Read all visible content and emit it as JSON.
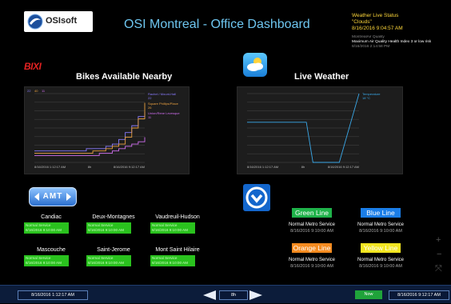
{
  "header": {
    "logo_text": "OSIsoft",
    "title": "OSI Montreal - Office Dashboard",
    "weather_status": {
      "label": "Weather Live Status",
      "condition": "\"Clouds\"",
      "timestamp": "8/16/2016 9:04:57 AM"
    },
    "air_quality": {
      "label": "MontrealAir Quality",
      "message": "Maximum Air Quality Health Index 3 or low risk",
      "timestamp": "8/16/2016 2:14:58 PM"
    }
  },
  "bikes": {
    "logo_text": "BIXI",
    "title": "Bikes Available Nearby",
    "legend_codes": [
      "22",
      "40",
      "11"
    ],
    "chart_data": {
      "type": "line",
      "title": "Bikes Available Nearby",
      "x_labels": [
        "8/16/2016 1:12:17 AM",
        "8h",
        "8/16/2016 9:12:17 AM"
      ],
      "series": [
        {
          "name": "Rachel / Mount-Hall",
          "value_text": "22",
          "color": "#8a7cff",
          "values": [
            5,
            5,
            5,
            5,
            5,
            5,
            5,
            5,
            6,
            6,
            6,
            7,
            8,
            10,
            13,
            16,
            20,
            22
          ]
        },
        {
          "name": "Square Phillips/Place",
          "value_text": "26",
          "color": "#e9a040",
          "values": [
            4,
            4,
            4,
            4,
            4,
            4,
            4,
            4,
            4,
            5,
            5,
            6,
            7,
            8,
            11,
            15,
            19,
            26
          ]
        },
        {
          "name": "Union/Rene Levesque",
          "value_text": "11",
          "color": "#d06ef0",
          "values": [
            3,
            3,
            3,
            3,
            3,
            3,
            3,
            3,
            3,
            3,
            4,
            4,
            5,
            6,
            7,
            8,
            9,
            11
          ]
        }
      ],
      "ylim": [
        0,
        30
      ],
      "grid": true
    }
  },
  "weather": {
    "icon": "cloud-sun-icon",
    "title": "Live Weather",
    "chart_data": {
      "type": "line",
      "title": "Live Weather",
      "x_labels": [
        "8/16/2016 1:12:17 AM",
        "8h",
        "8/16/2016 9:12:17 AM"
      ],
      "series": [
        {
          "name": "Temperature",
          "value_text": "18 °C",
          "color": "#3aa8e8",
          "values": [
            8,
            8,
            8,
            8,
            8,
            8,
            8,
            8,
            8,
            8,
            -6,
            -6,
            -6,
            -6,
            -6,
            2,
            10,
            18
          ]
        }
      ],
      "ylim": [
        -6,
        18
      ],
      "grid": true
    }
  },
  "amt": {
    "logo_text": "AMT",
    "stations": [
      {
        "name": "Candiac",
        "status": "Normal Service",
        "time": "8/16/2016 9:10:00 AM"
      },
      {
        "name": "Deux-Montagnes",
        "status": "Normal Service",
        "time": "8/16/2016 9:10:00 AM"
      },
      {
        "name": "Vaudreuil-Hudson",
        "status": "Normal Service",
        "time": "8/16/2016 9:10:00 AM"
      },
      {
        "name": "Mascouche",
        "status": "Normal Service",
        "time": "8/16/2016 9:10:00 AM"
      },
      {
        "name": "Saint-Jerome",
        "status": "Normal Service",
        "time": "8/16/2016 9:10:00 AM"
      },
      {
        "name": "Mont Saint Hilaire",
        "status": "Normal Service",
        "time": "8/16/2016 9:10:00 AM"
      }
    ]
  },
  "metro": {
    "icon": "metro-arrow-icon",
    "lines": [
      {
        "name": "Green Line",
        "bg": "#1fb34a",
        "fg": "#ffffff",
        "status": "Normal Metro Service",
        "time": "8/16/2016 9:10:00 AM"
      },
      {
        "name": "Blue Line",
        "bg": "#1b7ee8",
        "fg": "#ffffff",
        "status": "Normal Metro Service",
        "time": "8/16/2016 9:10:00 AM"
      },
      {
        "name": "Orange Line",
        "bg": "#f38a1f",
        "fg": "#ffffff",
        "status": "Normal Metro Service",
        "time": "8/16/2016 9:10:00 AM"
      },
      {
        "name": "Yellow Line",
        "bg": "#f2e520",
        "fg": "#ffffff",
        "status": "Normal Metro Service",
        "time": "8/16/2016 9:10:00 AM"
      }
    ]
  },
  "side_controls": [
    "+",
    "−",
    "⤧"
  ],
  "footer": {
    "start_time": "8/16/2016 1:12:17 AM",
    "duration": "8h",
    "now_label": "Now",
    "end_time": "8/16/2016 9:12:17 AM"
  }
}
